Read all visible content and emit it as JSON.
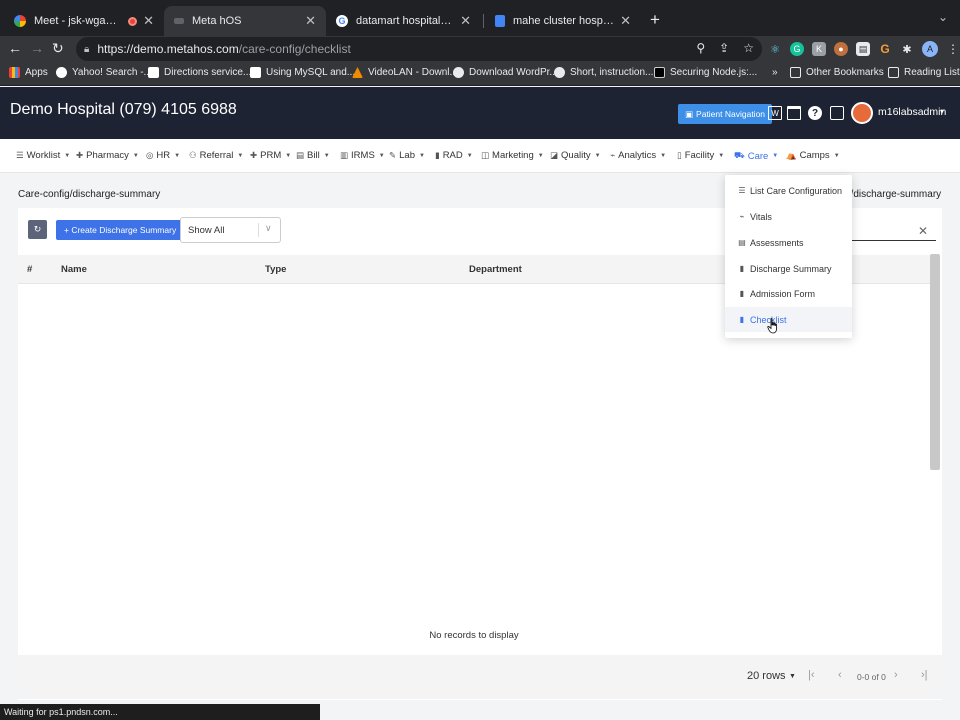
{
  "browser": {
    "tabs": [
      {
        "title": "Meet - jsk-wgaw-jbs",
        "favicon_color": "#34a853"
      },
      {
        "title": "Meta hOS",
        "favicon_color": "#5f6368"
      },
      {
        "title": "datamart hospital information",
        "favicon_color": "#ffffff"
      },
      {
        "title": "mahe cluster hospitals ehr req",
        "favicon_color": "#4285f4"
      }
    ],
    "url_host": "https://demo.metahos.com",
    "url_path": "/care-config/checklist",
    "bookmarks": [
      "Apps",
      "Yahoo! Search -...",
      "Directions service...",
      "Using MySQL and...",
      "VideoLAN - Downl...",
      "Download WordPr...",
      "Short, instruction...",
      "Securing Node.js:...",
      "»",
      "Other Bookmarks",
      "Reading List"
    ],
    "profile_initial": "A",
    "status_text": "Waiting for ps1.pndsn.com..."
  },
  "header": {
    "title": "Demo Hospital (079) 4105 6988",
    "patient_nav": "Patient Navigation",
    "username": "m16labsadmin"
  },
  "nav": [
    {
      "label": "Worklist",
      "icon": "☰"
    },
    {
      "label": "Pharmacy",
      "icon": "✚"
    },
    {
      "label": "HR",
      "icon": "◎"
    },
    {
      "label": "Referral",
      "icon": "⚇"
    },
    {
      "label": "PRM",
      "icon": "✚"
    },
    {
      "label": "Bill",
      "icon": "▤"
    },
    {
      "label": "IRMS",
      "icon": "▥"
    },
    {
      "label": "Lab",
      "icon": "✎"
    },
    {
      "label": "RAD",
      "icon": "▮"
    },
    {
      "label": "Marketing",
      "icon": "◫"
    },
    {
      "label": "Quality",
      "icon": "◪"
    },
    {
      "label": "Analytics",
      "icon": "⌁"
    },
    {
      "label": "Facility",
      "icon": "▯"
    },
    {
      "label": "Care",
      "icon": "⛟"
    },
    {
      "label": "Camps",
      "icon": "⛺"
    }
  ],
  "breadcrumb": "Care-config/discharge-summary",
  "breadcrumb_right": "g/discharge-summary",
  "toolbar": {
    "create_label": "+ Create Discharge Summary",
    "filter_value": "Show All"
  },
  "table": {
    "columns": [
      "#",
      "Name",
      "Type",
      "Department"
    ],
    "empty_text": "No records to display"
  },
  "pager": {
    "rows_label": "20 rows",
    "page_info": "0-0 of 0"
  },
  "dropdown": {
    "items": [
      {
        "label": "List Care Configuration",
        "icon": "☰"
      },
      {
        "label": "Vitals",
        "icon": "⌁"
      },
      {
        "label": "Assessments",
        "icon": "▤"
      },
      {
        "label": "Discharge Summary",
        "icon": "▮"
      },
      {
        "label": "Admission Form",
        "icon": "▮"
      },
      {
        "label": "Checklist",
        "icon": "▮"
      }
    ],
    "hovered_index": 5
  },
  "colors": {
    "header_bg": "#1d2333",
    "primary": "#3d72e8",
    "patient_nav": "#3d8fe8"
  }
}
